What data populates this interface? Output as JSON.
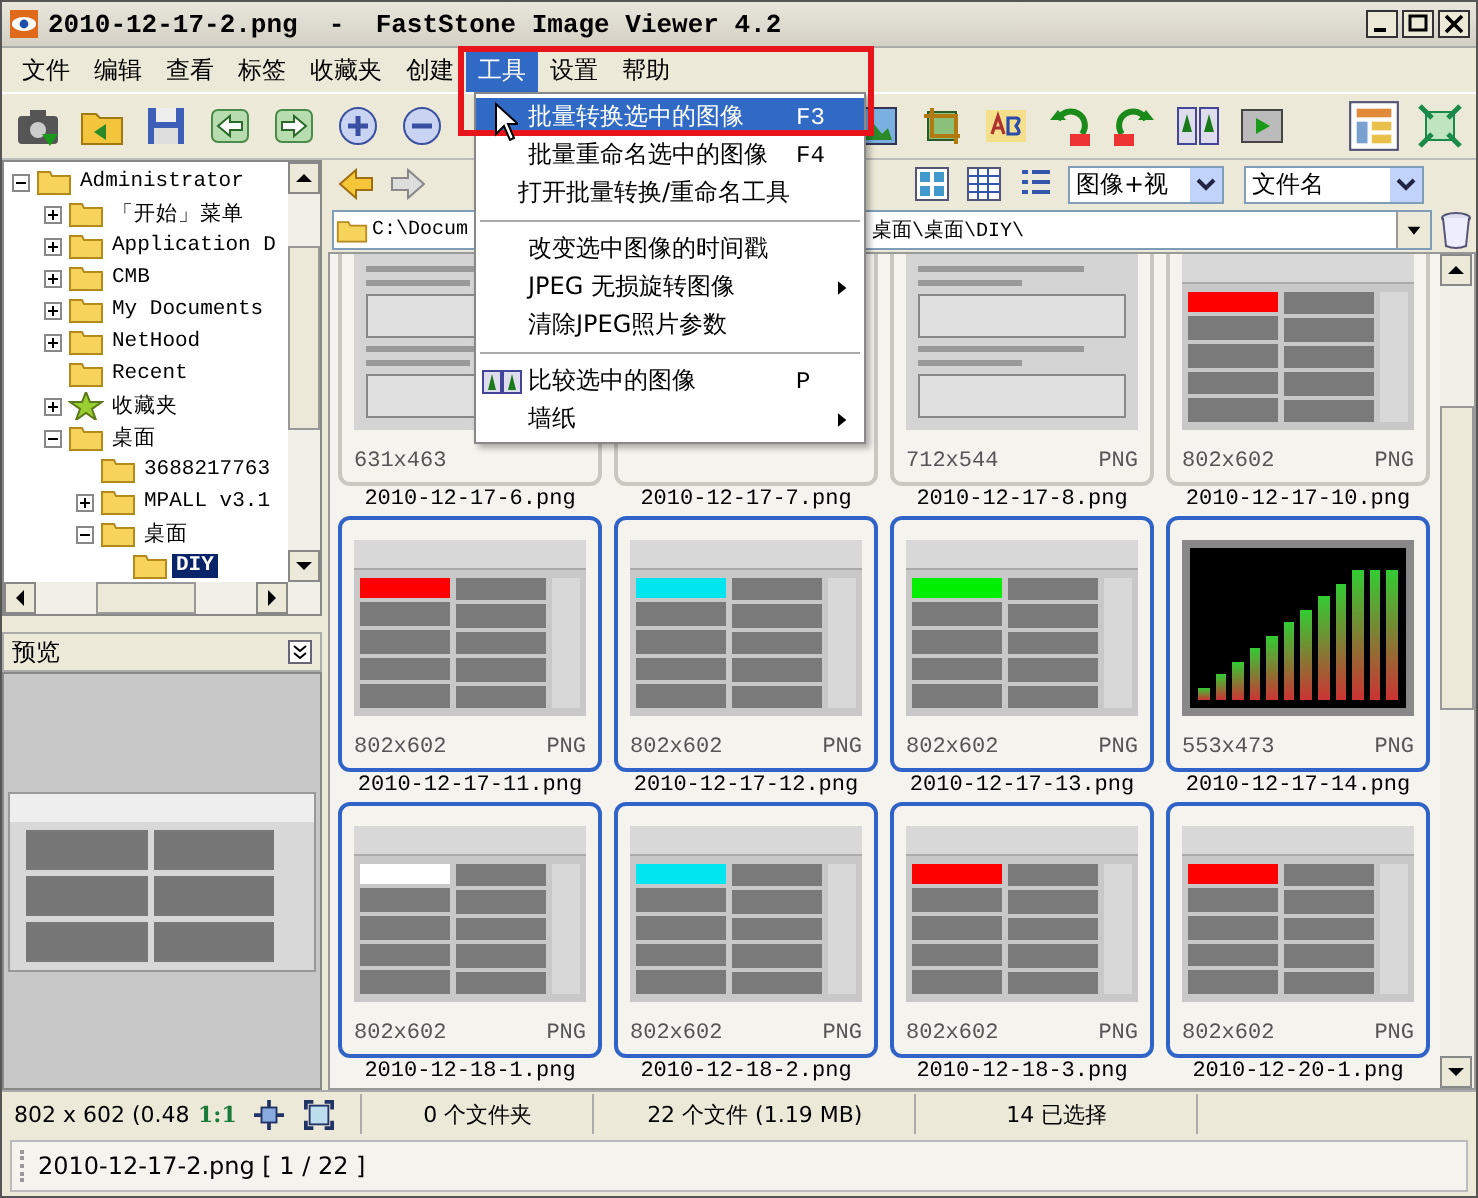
{
  "window": {
    "title": "2010-12-17-2.png  -  FastStone Image Viewer 4.2"
  },
  "menu_bar": [
    {
      "label": "文件",
      "selected": false
    },
    {
      "label": "编辑",
      "selected": false
    },
    {
      "label": "查看",
      "selected": false
    },
    {
      "label": "标签",
      "selected": false
    },
    {
      "label": "收藏夹",
      "selected": false
    },
    {
      "label": "创建",
      "selected": false
    },
    {
      "label": "工具",
      "selected": true
    },
    {
      "label": "设置",
      "selected": false
    },
    {
      "label": "帮助",
      "selected": false
    }
  ],
  "tools_menu": [
    {
      "kind": "item",
      "label": "批量转换选中的图像",
      "shortcut": "F3",
      "selected": true
    },
    {
      "kind": "item",
      "label": "批量重命名选中的图像",
      "shortcut": "F4",
      "selected": false
    },
    {
      "kind": "item",
      "label": "打开批量转换/重命名工具",
      "selected": false
    },
    {
      "kind": "separator"
    },
    {
      "kind": "item",
      "label": "改变选中图像的时间戳",
      "selected": false
    },
    {
      "kind": "submenu",
      "label": "JPEG 无损旋转图像",
      "selected": false
    },
    {
      "kind": "item",
      "label": "清除JPEG照片参数",
      "selected": false
    },
    {
      "kind": "separator"
    },
    {
      "kind": "icon_item",
      "label": "比较选中的图像",
      "shortcut": "P",
      "selected": false
    },
    {
      "kind": "submenu",
      "label": "墙纸",
      "selected": false
    }
  ],
  "folder_tree": [
    {
      "label": "Administrator",
      "kind": "folder",
      "expanded": true,
      "selected": false,
      "children": [
        {
          "label": "「开始」菜单",
          "kind": "folder",
          "expanded": false,
          "selected": false
        },
        {
          "label": "Application D",
          "kind": "folder",
          "expanded": false,
          "selected": false
        },
        {
          "label": "CMB",
          "kind": "folder",
          "expanded": false,
          "selected": false
        },
        {
          "label": "My Documents",
          "kind": "folder",
          "expanded": false,
          "selected": false
        },
        {
          "label": "NetHood",
          "kind": "folder",
          "expanded": false,
          "selected": false
        },
        {
          "label": "Recent",
          "kind": "folder",
          "selected": false
        },
        {
          "label": "收藏夹",
          "kind": "favorites",
          "expanded": false,
          "selected": false
        },
        {
          "label": "桌面",
          "kind": "folder",
          "expanded": true,
          "selected": false,
          "children": [
            {
              "label": "3688217763",
              "kind": "folder",
              "selected": false
            },
            {
              "label": "MPALL v3.1",
              "kind": "folder",
              "expanded": false,
              "selected": false
            },
            {
              "label": "桌面",
              "kind": "folder",
              "expanded": true,
              "selected": false,
              "children": [
                {
                  "label": "DIY",
                  "kind": "folder",
                  "selected": true
                }
              ]
            }
          ]
        }
      ]
    }
  ],
  "preview": {
    "title": "预览"
  },
  "filters": {
    "type_filter": "图像+视",
    "sort": "文件名"
  },
  "address": {
    "start": "C:\\Docum",
    "end": "桌面\\桌面\\DIY\\"
  },
  "thumbnails": [
    {
      "name": "2010-12-17-6.png",
      "size": "631x463",
      "kind": "dialog",
      "selected": false
    },
    {
      "name": "2010-12-17-7.png",
      "selected": false
    },
    {
      "name": "2010-12-17-8.png",
      "size": "712x544",
      "format": "PNG",
      "kind": "dialog",
      "selected": false
    },
    {
      "name": "2010-12-17-10.png",
      "size": "802x602",
      "format": "PNG",
      "kind": "panel",
      "color": "#ff0000",
      "selected": false
    },
    {
      "name": "2010-12-17-11.png",
      "size": "802x602",
      "format": "PNG",
      "kind": "panel",
      "color": "#ff0000",
      "selected": true
    },
    {
      "name": "2010-12-17-12.png",
      "size": "802x602",
      "format": "PNG",
      "kind": "panel",
      "color": "#00e5ee",
      "selected": true
    },
    {
      "name": "2010-12-17-13.png",
      "size": "802x602",
      "format": "PNG",
      "kind": "panel",
      "color": "#00ee00",
      "selected": true
    },
    {
      "name": "2010-12-17-14.png",
      "size": "553x473",
      "format": "PNG",
      "kind": "chart",
      "selected": true
    },
    {
      "name": "2010-12-18-1.png",
      "size": "802x602",
      "format": "PNG",
      "kind": "panel",
      "color": "#ffffff",
      "selected": true
    },
    {
      "name": "2010-12-18-2.png",
      "size": "802x602",
      "format": "PNG",
      "kind": "panel",
      "color": "#00e5ee",
      "selected": true
    },
    {
      "name": "2010-12-18-3.png",
      "size": "802x602",
      "format": "PNG",
      "kind": "panel",
      "color": "#ff0000",
      "selected": true
    },
    {
      "name": "2010-12-20-1.png",
      "size": "802x602",
      "format": "PNG",
      "kind": "panel",
      "color": "#ff0000",
      "selected": true
    }
  ],
  "status_bar": {
    "image_info": "802 x 602 (0.48",
    "zoom": "1:1",
    "folders": "0 个文件夹",
    "files": "22 个文件 (1.19 MB)",
    "selected": "14 已选择"
  },
  "file_bar": {
    "text": "2010-12-17-2.png [ 1 / 22 ]"
  }
}
